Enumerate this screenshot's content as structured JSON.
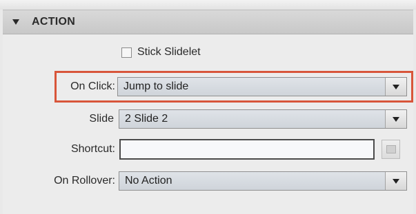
{
  "section": {
    "title": "ACTION"
  },
  "stick_slidelet": {
    "label": "Stick Slidelet",
    "checked": false
  },
  "on_click": {
    "label": "On Click:",
    "value": "Jump to slide"
  },
  "slide": {
    "label": "Slide",
    "value": "2 Slide 2"
  },
  "shortcut": {
    "label": "Shortcut:",
    "value": ""
  },
  "on_rollover": {
    "label": "On Rollover:",
    "value": "No Action"
  },
  "colors": {
    "highlight": "#d8553a",
    "header_bg": "#d0d0d0",
    "panel_bg": "#ececec"
  }
}
